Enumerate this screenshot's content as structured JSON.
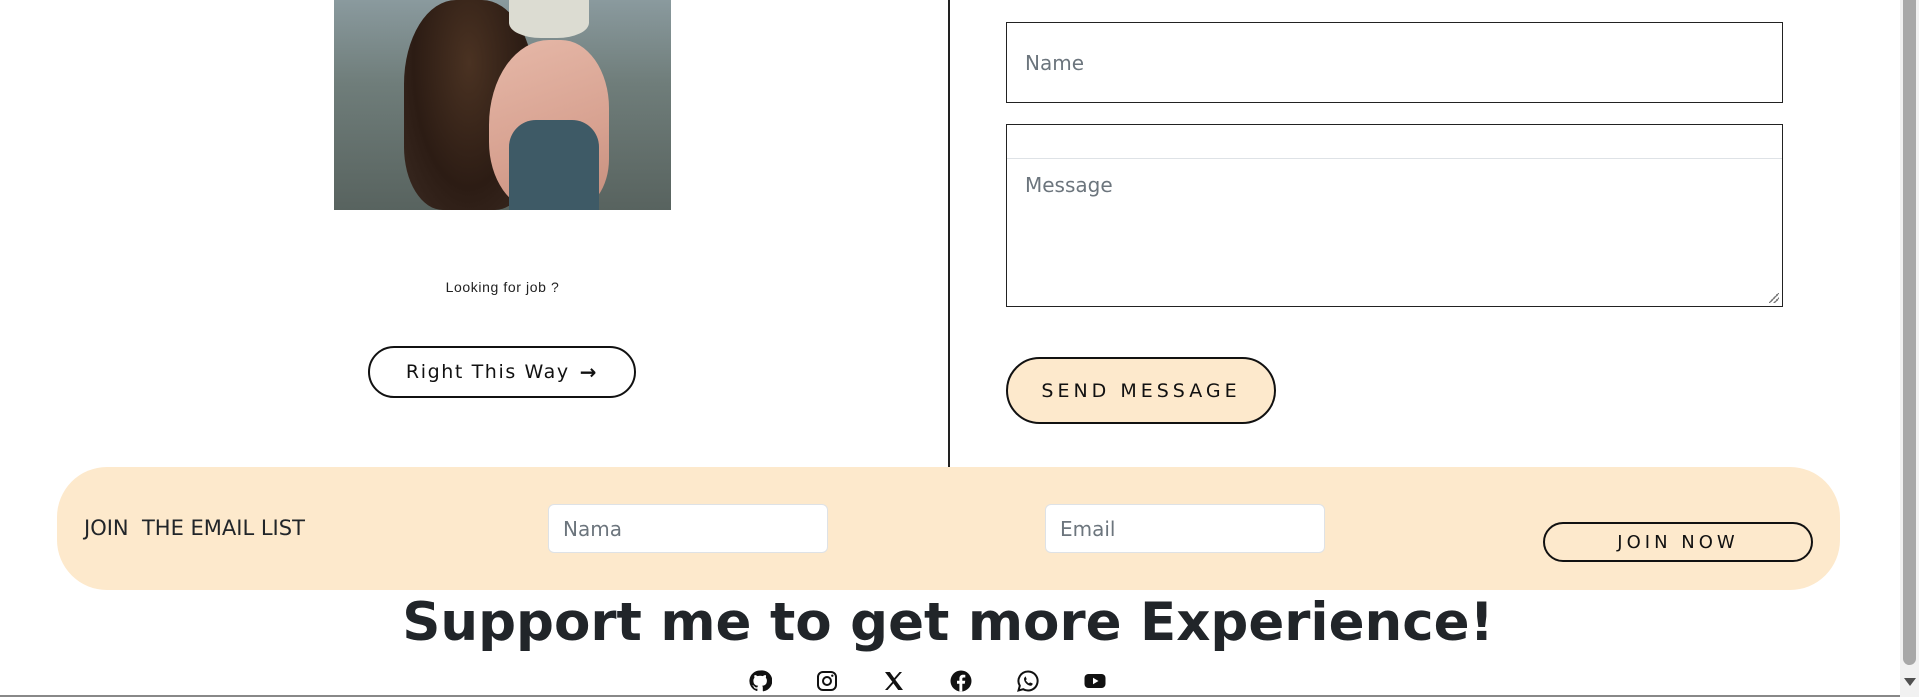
{
  "left": {
    "looking_text": "Looking for job ?",
    "right_this_way_label": "Right This Way"
  },
  "contact_form": {
    "name_placeholder": "Name",
    "message_placeholder": "Message",
    "send_label": "SEND MESSAGE"
  },
  "email_list": {
    "label": "JOIN  THE EMAIL LIST",
    "name_placeholder": "Nama",
    "email_placeholder": "Email",
    "join_label": "JOIN NOW",
    "background_color": "#fde9cc"
  },
  "support": {
    "heading": "Support me to get more Experience!"
  },
  "social_icons": [
    "github-icon",
    "instagram-icon",
    "x-icon",
    "facebook-icon",
    "whatsapp-icon",
    "youtube-icon"
  ],
  "colors": {
    "accent": "#fde9cc",
    "text": "#212529",
    "border": "#111111"
  }
}
